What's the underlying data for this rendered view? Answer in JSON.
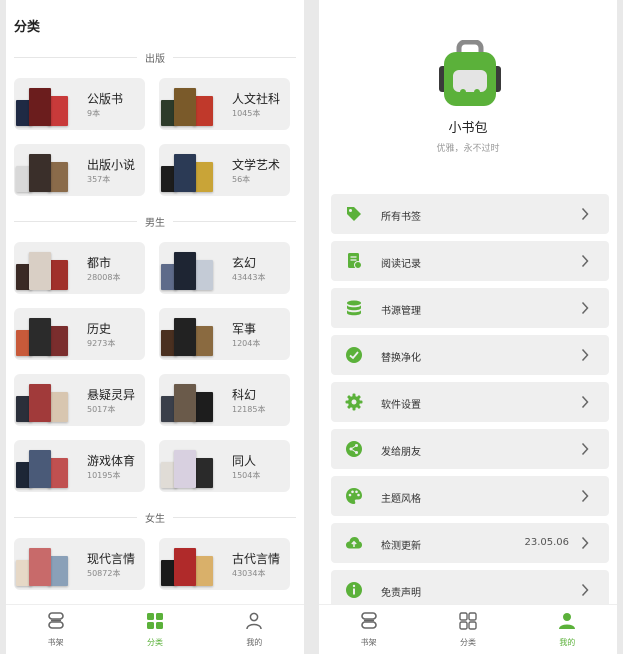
{
  "categories_screen": {
    "title": "分类",
    "sections": [
      {
        "title": "出版",
        "items": [
          {
            "name": "公版书",
            "count": "9本"
          },
          {
            "name": "人文社科",
            "count": "1045本"
          },
          {
            "name": "出版小说",
            "count": "357本"
          },
          {
            "name": "文学艺术",
            "count": "56本"
          }
        ]
      },
      {
        "title": "男生",
        "items": [
          {
            "name": "都市",
            "count": "28008本"
          },
          {
            "name": "玄幻",
            "count": "43443本"
          },
          {
            "name": "历史",
            "count": "9273本"
          },
          {
            "name": "军事",
            "count": "1204本"
          },
          {
            "name": "悬疑灵异",
            "count": "5017本"
          },
          {
            "name": "科幻",
            "count": "12185本"
          },
          {
            "name": "游戏体育",
            "count": "10195本"
          },
          {
            "name": "同人",
            "count": "1504本"
          }
        ]
      },
      {
        "title": "女生",
        "items": [
          {
            "name": "现代言情",
            "count": "50872本"
          },
          {
            "name": "古代言情",
            "count": "43034本"
          },
          {
            "name": "",
            "count": ""
          },
          {
            "name": "",
            "count": ""
          }
        ]
      }
    ],
    "tabbar": [
      {
        "label": "书架",
        "icon": "bookshelf-icon",
        "active": false
      },
      {
        "label": "分类",
        "icon": "category-grid-icon",
        "active": true
      },
      {
        "label": "我的",
        "icon": "person-icon",
        "active": false
      }
    ]
  },
  "mine_screen": {
    "app_name": "小书包",
    "slogan": "优雅，永不过时",
    "menu": [
      {
        "label": "所有书签",
        "icon": "bookmark-tag-icon",
        "value": ""
      },
      {
        "label": "阅读记录",
        "icon": "reading-record-icon",
        "value": ""
      },
      {
        "label": "书源管理",
        "icon": "database-icon",
        "value": ""
      },
      {
        "label": "替换净化",
        "icon": "check-circle-icon",
        "value": ""
      },
      {
        "label": "软件设置",
        "icon": "gear-icon",
        "value": ""
      },
      {
        "label": "发给朋友",
        "icon": "share-icon",
        "value": ""
      },
      {
        "label": "主题风格",
        "icon": "palette-icon",
        "value": ""
      },
      {
        "label": "检测更新",
        "icon": "cloud-upload-icon",
        "value": "23.05.06"
      },
      {
        "label": "免责声明",
        "icon": "info-icon",
        "value": ""
      }
    ],
    "tabbar": [
      {
        "label": "书架",
        "icon": "bookshelf-icon",
        "active": false
      },
      {
        "label": "分类",
        "icon": "category-grid-icon",
        "active": false
      },
      {
        "label": "我的",
        "icon": "person-icon",
        "active": true
      }
    ]
  },
  "colors": {
    "accent": "#5bb13a",
    "card_bg": "#efefef",
    "text_secondary": "#888888"
  }
}
